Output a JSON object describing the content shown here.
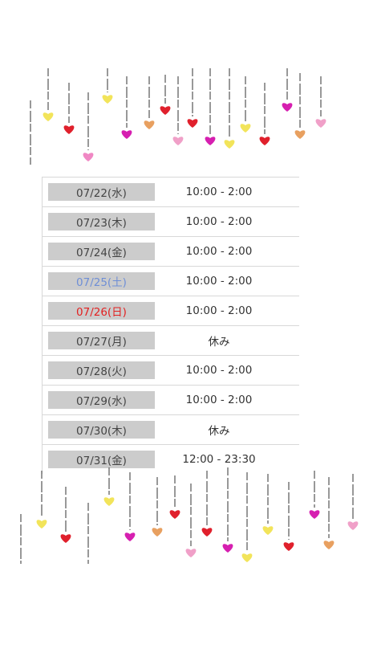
{
  "schedule": {
    "rows": [
      {
        "date": "07/22(水)",
        "hours": "10:00 - 2:00",
        "kind": "weekday"
      },
      {
        "date": "07/23(木)",
        "hours": "10:00 - 2:00",
        "kind": "weekday"
      },
      {
        "date": "07/24(金)",
        "hours": "10:00 - 2:00",
        "kind": "weekday"
      },
      {
        "date": "07/25(土)",
        "hours": "10:00 - 2:00",
        "kind": "saturday"
      },
      {
        "date": "07/26(日)",
        "hours": "10:00 - 2:00",
        "kind": "sunday"
      },
      {
        "date": "07/27(月)",
        "hours": "休み",
        "kind": "weekday"
      },
      {
        "date": "07/28(火)",
        "hours": "10:00 - 2:00",
        "kind": "weekday"
      },
      {
        "date": "07/29(水)",
        "hours": "10:00 - 2:00",
        "kind": "weekday"
      },
      {
        "date": "07/30(木)",
        "hours": "休み",
        "kind": "weekday"
      },
      {
        "date": "07/31(金)",
        "hours": "12:00 - 23:30",
        "kind": "weekday"
      }
    ]
  },
  "colors": {
    "saturday": "#6f8fd6",
    "sunday": "#e22121",
    "date_cell_bg": "#cccccc",
    "heart_colors": [
      "#d61fb0",
      "#f2e45a",
      "#e0202c",
      "#f088c4",
      "#e8a060",
      "#f0a0c8"
    ]
  },
  "decor": {
    "icon": "hanging-heart-icon"
  }
}
